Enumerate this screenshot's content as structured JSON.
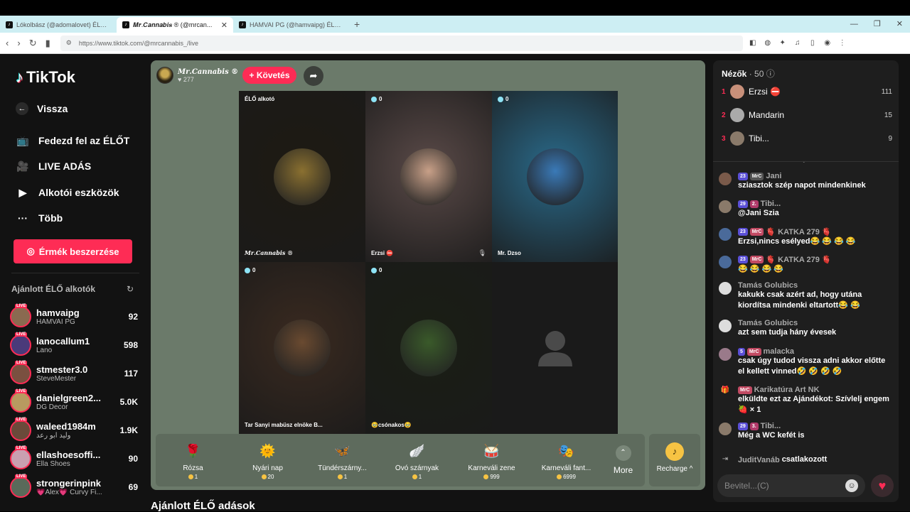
{
  "browser": {
    "tabs": [
      {
        "title": "Lókolbász (@adomalovet) ÉLŐ adás...",
        "active": false
      },
      {
        "title": "𝑴𝒓.𝑪𝒂𝒏𝒏𝒂𝒃𝒊𝒔 ® (@mrcan...",
        "active": true
      },
      {
        "title": "HAMVAI PG (@hamvaipg) ÉLŐ adás...",
        "active": false
      }
    ],
    "url": "https://www.tiktok.com/@mrcannabis_/live",
    "new_tab": "+",
    "window_controls": [
      "—",
      "❐",
      "✕"
    ]
  },
  "sidebar": {
    "brand": "TikTok",
    "back": "Vissza",
    "nav": [
      "Fedezd fel az ÉLŐT",
      "LIVE ADÁS",
      "Alkotói eszközök",
      "Több"
    ],
    "coins_button": "Érmék beszerzése",
    "recommended_title": "Ajánlott ÉLŐ alkotók",
    "live_badge": "LIVE",
    "creators": [
      {
        "user": "hamvaipg",
        "sub": "HAMVAI PG",
        "count": "92",
        "color": "#8a6a50"
      },
      {
        "user": "lanocallum1",
        "sub": "Lano",
        "count": "598",
        "color": "#4a3a7a"
      },
      {
        "user": "stmester3.0",
        "sub": "SteveMester",
        "count": "117",
        "color": "#7a5040"
      },
      {
        "user": "danielgreen2...",
        "sub": "DG Decor",
        "count": "5.0K",
        "color": "#b89a60"
      },
      {
        "user": "waleed1984m",
        "sub": "وليد ابو رعد",
        "count": "1.9K",
        "color": "#6a4a3a"
      },
      {
        "user": "ellashoesoffi...",
        "sub": "Ella Shoes",
        "count": "90",
        "color": "#c9a0b0"
      },
      {
        "user": "strongerinpink",
        "sub": "💗Alex💗 Curvy Fi...",
        "count": "69",
        "color": "#5a6a5a"
      }
    ]
  },
  "stream": {
    "host_name": "𝑴𝒓.𝑪𝒂𝒏𝒏𝒂𝒃𝒊𝒔 ®",
    "likes": "277",
    "follow": "+ Követés",
    "cells": [
      {
        "tag": "ÉLŐ alkotó",
        "label": "𝑴𝒓.𝑪𝒂𝒏𝒏𝒂𝒃𝒊𝒔 ®",
        "bg": "#1e1a12",
        "bubble": "#8a7030"
      },
      {
        "tag": "0",
        "label": "Erzsi ⛔",
        "bg": "#5a4a48",
        "bubble": "#c8a088"
      },
      {
        "tag": "0",
        "label": "Mr. Dzso",
        "bg": "#2a6a8a",
        "bubble": "#3a7ab8"
      },
      {
        "tag": "0",
        "label": "Tar Sanyi mabüsz elnöke B...",
        "bg": "#3a2a20",
        "bubble": "#6a4a30"
      },
      {
        "tag": "0",
        "label": "🥹csónakos🥹",
        "bg": "#1a1e14",
        "bubble": "#3a5a2a"
      },
      {
        "tag": "",
        "label": "",
        "bg": "#1a1a1a",
        "bubble": ""
      }
    ],
    "gifts": [
      {
        "name": "Rózsa",
        "price": "1",
        "icon": "🌹"
      },
      {
        "name": "Nyári nap",
        "price": "20",
        "icon": "🌞"
      },
      {
        "name": "Tündérszárny...",
        "price": "1",
        "icon": "🦋"
      },
      {
        "name": "Óvó szárnyak",
        "price": "1",
        "icon": "🪽"
      },
      {
        "name": "Karneváli zene",
        "price": "999",
        "icon": "🥁"
      },
      {
        "name": "Karneváli fant...",
        "price": "6999",
        "icon": "🎭"
      }
    ],
    "more": "More",
    "recharge": "Recharge ^",
    "below_title": "Ajánlott ÉLŐ adások"
  },
  "chat": {
    "viewers_label": "Nézők",
    "viewers_count": "· 50",
    "top_viewers": [
      {
        "rank": "1",
        "name": "Erzsi ⛔",
        "score": "111",
        "color": "#c8907a"
      },
      {
        "rank": "2",
        "name": "Mandarin",
        "score": "15",
        "color": "#aaaaaa"
      },
      {
        "rank": "3",
        "name": "Tibi...",
        "score": "9",
        "color": "#8a7a6a"
      }
    ],
    "messages": [
      {
        "user": "Jani",
        "badges": [
          {
            "t": "23",
            "c": "b-lvl"
          },
          {
            "t": "MrC",
            "c": "b-gray"
          }
        ],
        "text": "sziasztok szép napot mindenkinek",
        "color": "#7a5a4a"
      },
      {
        "user": "Tibi...",
        "badges": [
          {
            "t": "29",
            "c": "b-lvl"
          },
          {
            "t": "2.",
            "c": "b-pink"
          }
        ],
        "text": "@Jani Szia",
        "color": "#8a7a6a"
      },
      {
        "user": "🫀 KATKA 279 🫀",
        "badges": [
          {
            "t": "23",
            "c": "b-lvl"
          },
          {
            "t": "MrC",
            "c": "b-fan"
          }
        ],
        "text": "Erzsi,nincs esélyed😂 😂 😂 😂",
        "color": "#4a6a9a"
      },
      {
        "user": "🫀 KATKA 279 🫀",
        "badges": [
          {
            "t": "23",
            "c": "b-lvl"
          },
          {
            "t": "MrC",
            "c": "b-fan"
          }
        ],
        "text": "😂 😂 😂 😂",
        "color": "#4a6a9a"
      },
      {
        "user": "Tamás Golubics",
        "badges": [],
        "text": "kakukk csak azért ad, hogy utána kiordítsa mindenki eltartott😂 😂",
        "color": "#dddddd"
      },
      {
        "user": "Tamás Golubics",
        "badges": [],
        "text": "azt sem tudja hány évesek",
        "color": "#dddddd"
      },
      {
        "user": "malacka",
        "badges": [
          {
            "t": "5",
            "c": "b-lvl"
          },
          {
            "t": "MrC",
            "c": "b-fan"
          }
        ],
        "text": "csak úgy tudod vissza adni akkor előtte el kellett vinned🤣 🤣 🤣 🤣",
        "color": "#9a7a8a"
      },
      {
        "user": "Karikatúra Art NK",
        "badges": [
          {
            "t": "MrC",
            "c": "b-fan"
          }
        ],
        "text": "elküldte ezt az Ajándékot: Szívlelj engem 🍓 × 1",
        "color": "#444444",
        "icon": "gift"
      },
      {
        "user": "Tibi...",
        "badges": [
          {
            "t": "29",
            "c": "b-lvl"
          },
          {
            "t": "3.",
            "c": "b-pink"
          }
        ],
        "text": "Még a WC kefét is",
        "color": "#8a7a6a"
      },
      {
        "user": "JuditVanáb",
        "badges": [],
        "text": "csatlakozott",
        "color": "#444444",
        "icon": "join"
      }
    ],
    "input_placeholder": "Bevitel...(C)"
  }
}
